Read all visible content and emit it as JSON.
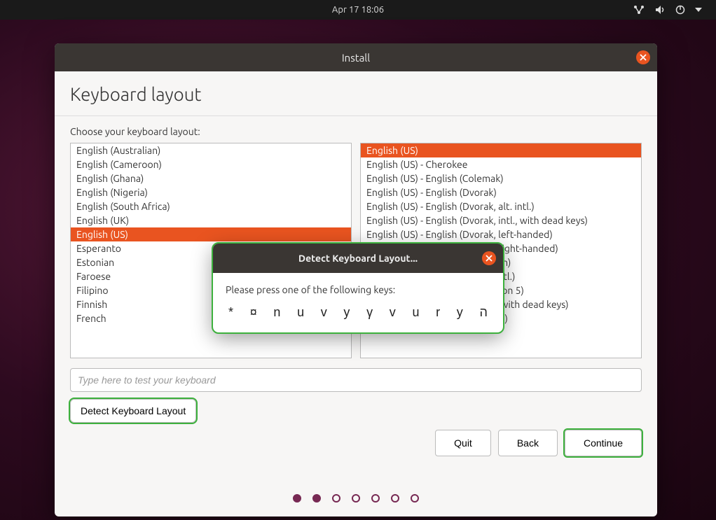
{
  "topbar": {
    "datetime": "Apr 17  18:06"
  },
  "window": {
    "title": "Install",
    "page_title": "Keyboard layout",
    "prompt": "Choose your keyboard layout:",
    "left_list": [
      "English (Australian)",
      "English (Cameroon)",
      "English (Ghana)",
      "English (Nigeria)",
      "English (South Africa)",
      "English (UK)",
      "English (US)",
      "Esperanto",
      "Estonian",
      "Faroese",
      "Filipino",
      "Finnish",
      "French"
    ],
    "left_selected_index": 6,
    "right_list": [
      "English (US)",
      "English (US) - Cherokee",
      "English (US) - English (Colemak)",
      "English (US) - English (Dvorak)",
      "English (US) - English (Dvorak, alt. intl.)",
      "English (US) - English (Dvorak, intl., with dead keys)",
      "English (US) - English (Dvorak, left-handed)",
      "English (US) - English (Dvorak, right-handed)",
      "English (US) - English (Macintosh)",
      "English (US) - English (US, alt. intl.)",
      "English (US) - English (US, euro on 5)",
      "English (US) - English (US, intl., with dead keys)",
      "English (US) - English (Workman)"
    ],
    "right_selected_index": 0,
    "test_placeholder": "Type here to test your keyboard",
    "detect_label": "Detect Keyboard Layout",
    "buttons": {
      "quit": "Quit",
      "back": "Back",
      "continue": "Continue"
    }
  },
  "modal": {
    "title": "Detect Keyboard Layout...",
    "message": "Please press one of the following keys:",
    "keys": [
      "*",
      "¤",
      "n",
      "u",
      "v",
      "y",
      "γ",
      "v",
      "u",
      "r",
      "y",
      "ה"
    ]
  }
}
